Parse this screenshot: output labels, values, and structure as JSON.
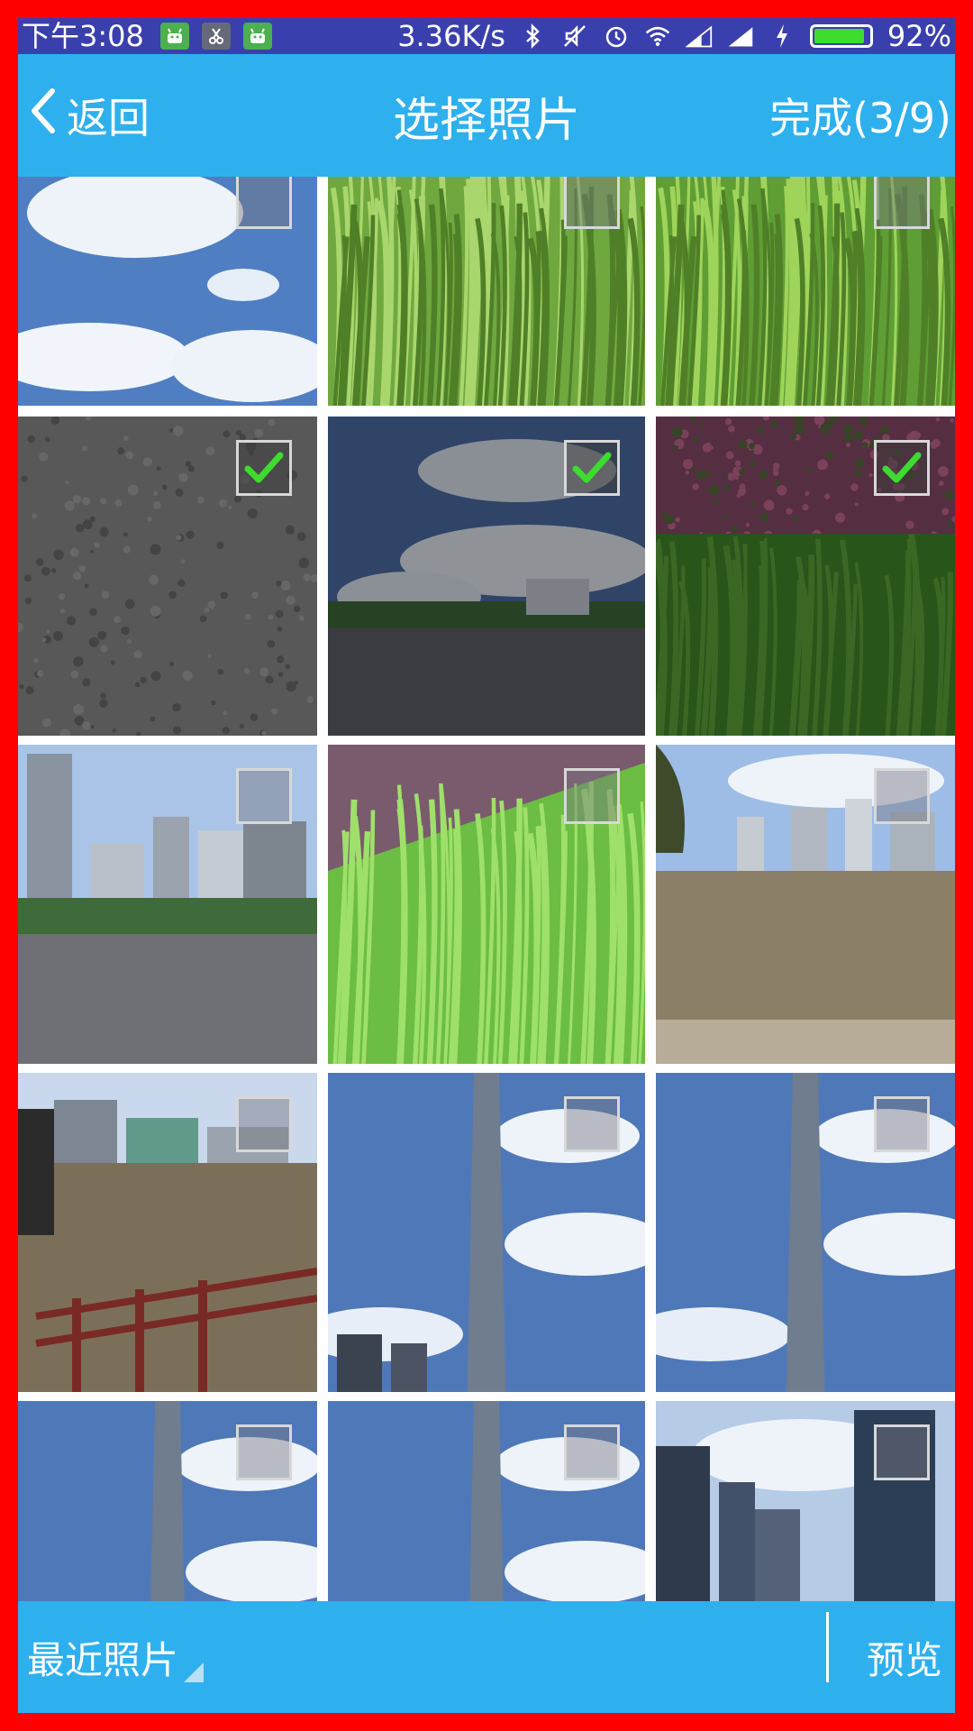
{
  "status_bar": {
    "time": "下午3:08",
    "network_speed": "3.36K/s",
    "battery_percent": "92%",
    "battery_level": 0.92,
    "app_icons": [
      "android-icon",
      "scissors-app-icon",
      "android-icon"
    ],
    "system_icons": [
      "bluetooth-icon",
      "mute-icon",
      "alarm-icon",
      "wifi-icon",
      "signal-icon",
      "signal-icon",
      "charging-icon"
    ]
  },
  "header": {
    "back_label": "返回",
    "title": "选择照片",
    "done_label": "完成(3/9)",
    "background": "#2fb0ee"
  },
  "photos": [
    {
      "id": "sky-clouds-1",
      "selected": false
    },
    {
      "id": "grass-closeup-1",
      "selected": false
    },
    {
      "id": "grass-closeup-2",
      "selected": false
    },
    {
      "id": "concrete-ground",
      "selected": true
    },
    {
      "id": "plaza-sky",
      "selected": true
    },
    {
      "id": "shrub-grass",
      "selected": true
    },
    {
      "id": "city-plaza",
      "selected": false
    },
    {
      "id": "grass-slope",
      "selected": false
    },
    {
      "id": "river-skyline-1",
      "selected": false
    },
    {
      "id": "river-railing",
      "selected": false
    },
    {
      "id": "canton-tower-sky-1",
      "selected": false
    },
    {
      "id": "canton-tower-sky-2",
      "selected": false
    },
    {
      "id": "canton-tower-sky-3",
      "selected": false
    },
    {
      "id": "canton-tower-sky-4",
      "selected": false
    },
    {
      "id": "city-buildings",
      "selected": false
    }
  ],
  "bottom_bar": {
    "album_label": "最近照片",
    "preview_label": "预览"
  },
  "colors": {
    "accent": "#2fb0ee",
    "status_bar": "#3a3fae",
    "check": "#3ddc2f",
    "frame": "#ff0000"
  }
}
